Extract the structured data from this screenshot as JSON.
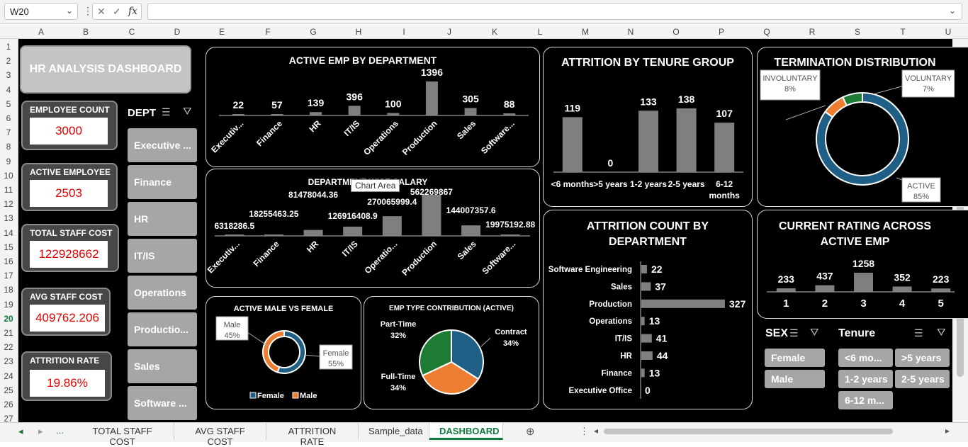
{
  "formula_bar": {
    "cell_ref": "W20",
    "cancel": "✕",
    "enter": "✓",
    "fx": "fx",
    "content": ""
  },
  "columns": [
    "A",
    "B",
    "C",
    "D",
    "E",
    "F",
    "G",
    "H",
    "I",
    "J",
    "K",
    "L",
    "M",
    "N",
    "O",
    "P",
    "Q",
    "R",
    "S",
    "T",
    "U"
  ],
  "rows": [
    "1",
    "2",
    "3",
    "4",
    "5",
    "6",
    "7",
    "8",
    "9",
    "10",
    "11",
    "12",
    "13",
    "14",
    "15",
    "16",
    "17",
    "18",
    "19",
    "20",
    "21",
    "22",
    "23",
    "24",
    "25",
    "26",
    "27"
  ],
  "dashboard_title": "HR ANALYSIS DASHBOARD",
  "kpis": {
    "employee_count": {
      "label": "EMPLOYEE COUNT",
      "value": "3000"
    },
    "active_employee": {
      "label": "ACTIVE EMPLOYEE",
      "value": "2503"
    },
    "total_staff_cost": {
      "label": "TOTAL STAFF COST",
      "value": "122928662"
    },
    "avg_staff_cost": {
      "label": "AVG STAFF COST",
      "value": "409762.206"
    },
    "attrition_rate": {
      "label": "ATTRITION RATE",
      "value": "19.86%"
    }
  },
  "dept_slicer": {
    "title": "DEPT",
    "items": [
      "Executive ...",
      "Finance",
      "HR",
      "IT/IS",
      "Operations",
      "Productio...",
      "Sales",
      "Software ..."
    ]
  },
  "sex_slicer": {
    "title": "SEX",
    "items": [
      "Female",
      "Male"
    ]
  },
  "tenure_slicer": {
    "title": "Tenure",
    "items": [
      "<6 mo...",
      ">5 years",
      "1-2 years",
      "2-5 years",
      "6-12 m..."
    ]
  },
  "tooltip": "Chart Area",
  "chart_data": [
    {
      "type": "bar",
      "title": "ACTIVE EMP BY DEPARTMENT",
      "categories": [
        "Executiv...",
        "Finance",
        "HR",
        "IT/IS",
        "Operations",
        "Production",
        "Sales",
        "Software..."
      ],
      "values": [
        22,
        57,
        139,
        396,
        100,
        1396,
        305,
        88
      ]
    },
    {
      "type": "bar",
      "title": "DEPARTMENT WISE SALARY",
      "categories": [
        "Executiv...",
        "Finance",
        "HR",
        "IT/IS",
        "Operatio...",
        "Production",
        "Sales",
        "Software..."
      ],
      "values": [
        6318286.5,
        18255463.25,
        81478044.36,
        126916408.9,
        270065999.4,
        562269867,
        144007357.6,
        19975192.88
      ],
      "labels": [
        "6318286.5",
        "18255463.25",
        "81478044.36",
        "126916408.9",
        "270065999.4",
        "562269867",
        "144007357.6",
        "19975192.88"
      ]
    },
    {
      "type": "bar",
      "title": "ATTRITION BY TENURE GROUP",
      "categories": [
        "<6 months",
        ">5 years",
        "1-2 years",
        "2-5 years",
        "6-12 months"
      ],
      "values": [
        119,
        0,
        133,
        138,
        107
      ]
    },
    {
      "type": "pie",
      "title": "TERMINATION DISTRIBUTION",
      "labels": [
        "INVOLUNTARY",
        "VOLUNTARY",
        "ACTIVE"
      ],
      "values": [
        8,
        7,
        85
      ],
      "pct_labels": [
        "8%",
        "7%",
        "85%"
      ],
      "colors": [
        "#ed7d31",
        "#1e7b34",
        "#1f5f85"
      ]
    },
    {
      "type": "bar",
      "orientation": "horizontal",
      "title": "ATTRITION COUNT BY DEPARTMENT",
      "categories": [
        "Software Engineering",
        "Sales",
        "Production",
        "Operations",
        "IT/IS",
        "HR",
        "Finance",
        "Executive Office"
      ],
      "values": [
        22,
        37,
        327,
        13,
        41,
        44,
        13,
        0
      ]
    },
    {
      "type": "bar",
      "title": "CURRENT RATING ACROSS ACTIVE EMP",
      "categories": [
        "1",
        "2",
        "3",
        "4",
        "5"
      ],
      "values": [
        233,
        437,
        1258,
        352,
        223
      ]
    },
    {
      "type": "pie",
      "title": "ACTIVE MALE VS FEMALE",
      "labels": [
        "Female",
        "Male"
      ],
      "values": [
        55,
        45
      ],
      "pct_labels": [
        "55%",
        "45%"
      ],
      "colors": [
        "#1f5f85",
        "#ed7d31"
      ]
    },
    {
      "type": "pie",
      "title": "EMP TYPE CONTRIBUTION (ACTIVE)",
      "labels": [
        "Contract",
        "Full-Time",
        "Part-Time"
      ],
      "values": [
        34,
        34,
        32
      ],
      "pct_labels": [
        "34%",
        "34%",
        "32%"
      ],
      "colors": [
        "#1f5f85",
        "#ed7d31",
        "#1e7b34"
      ]
    }
  ],
  "sheet_tabs": {
    "ellipsis": "...",
    "items": [
      "TOTAL STAFF COST",
      "AVG STAFF COST",
      "ATTRITION RATE",
      "Sample_data",
      "DASHBOARD"
    ],
    "active": "DASHBOARD"
  }
}
